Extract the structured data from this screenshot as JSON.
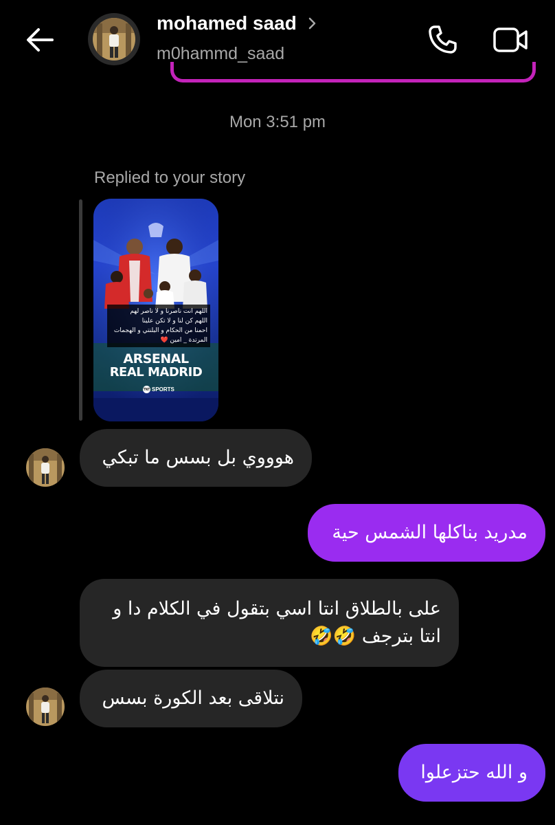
{
  "header": {
    "display_name": "mohamed saad",
    "username": "m0hammd_saad"
  },
  "thread": {
    "timestamp": "Mon 3:51 pm",
    "reply_caption": "Replied to your story"
  },
  "story": {
    "caption_lines": [
      "اللهم انت ناصرنا و لا ناصر لهم",
      "اللهم كن لنا و لا تكن علينا",
      "احمنا من الحكام و البلنتي و الهجمات",
      "المرتدة _ امين ❤️"
    ],
    "title_line1": "ARSENAL",
    "title_line2": "REAL MADRID",
    "brand_badge": "TNT",
    "brand": "SPORTS"
  },
  "messages": [
    {
      "side": "in",
      "text": "هوووي بل بسس ما تبكي"
    },
    {
      "side": "out",
      "text": "مدريد بناكلها الشمس حية"
    },
    {
      "side": "in",
      "text": "على بالطلاق انتا اسي بتقول في الكلام دا و انتا بترجف 🤣🤣"
    },
    {
      "side": "in",
      "text": "نتلاقى بعد الكورة بسس"
    },
    {
      "side": "out",
      "text": "و الله حتزعلوا"
    }
  ],
  "colors": {
    "background": "#000000",
    "incoming_bubble": "#262626",
    "outgoing_bubble_top": "#9a2cf0",
    "outgoing_bubble_bottom": "#7a38f2",
    "secondary_text": "#a8a8a8",
    "accent_edge": "#c323ba"
  },
  "icons": {
    "back": "back-arrow-icon",
    "call": "phone-icon",
    "video": "video-camera-icon",
    "chevron": "chevron-right-icon"
  }
}
